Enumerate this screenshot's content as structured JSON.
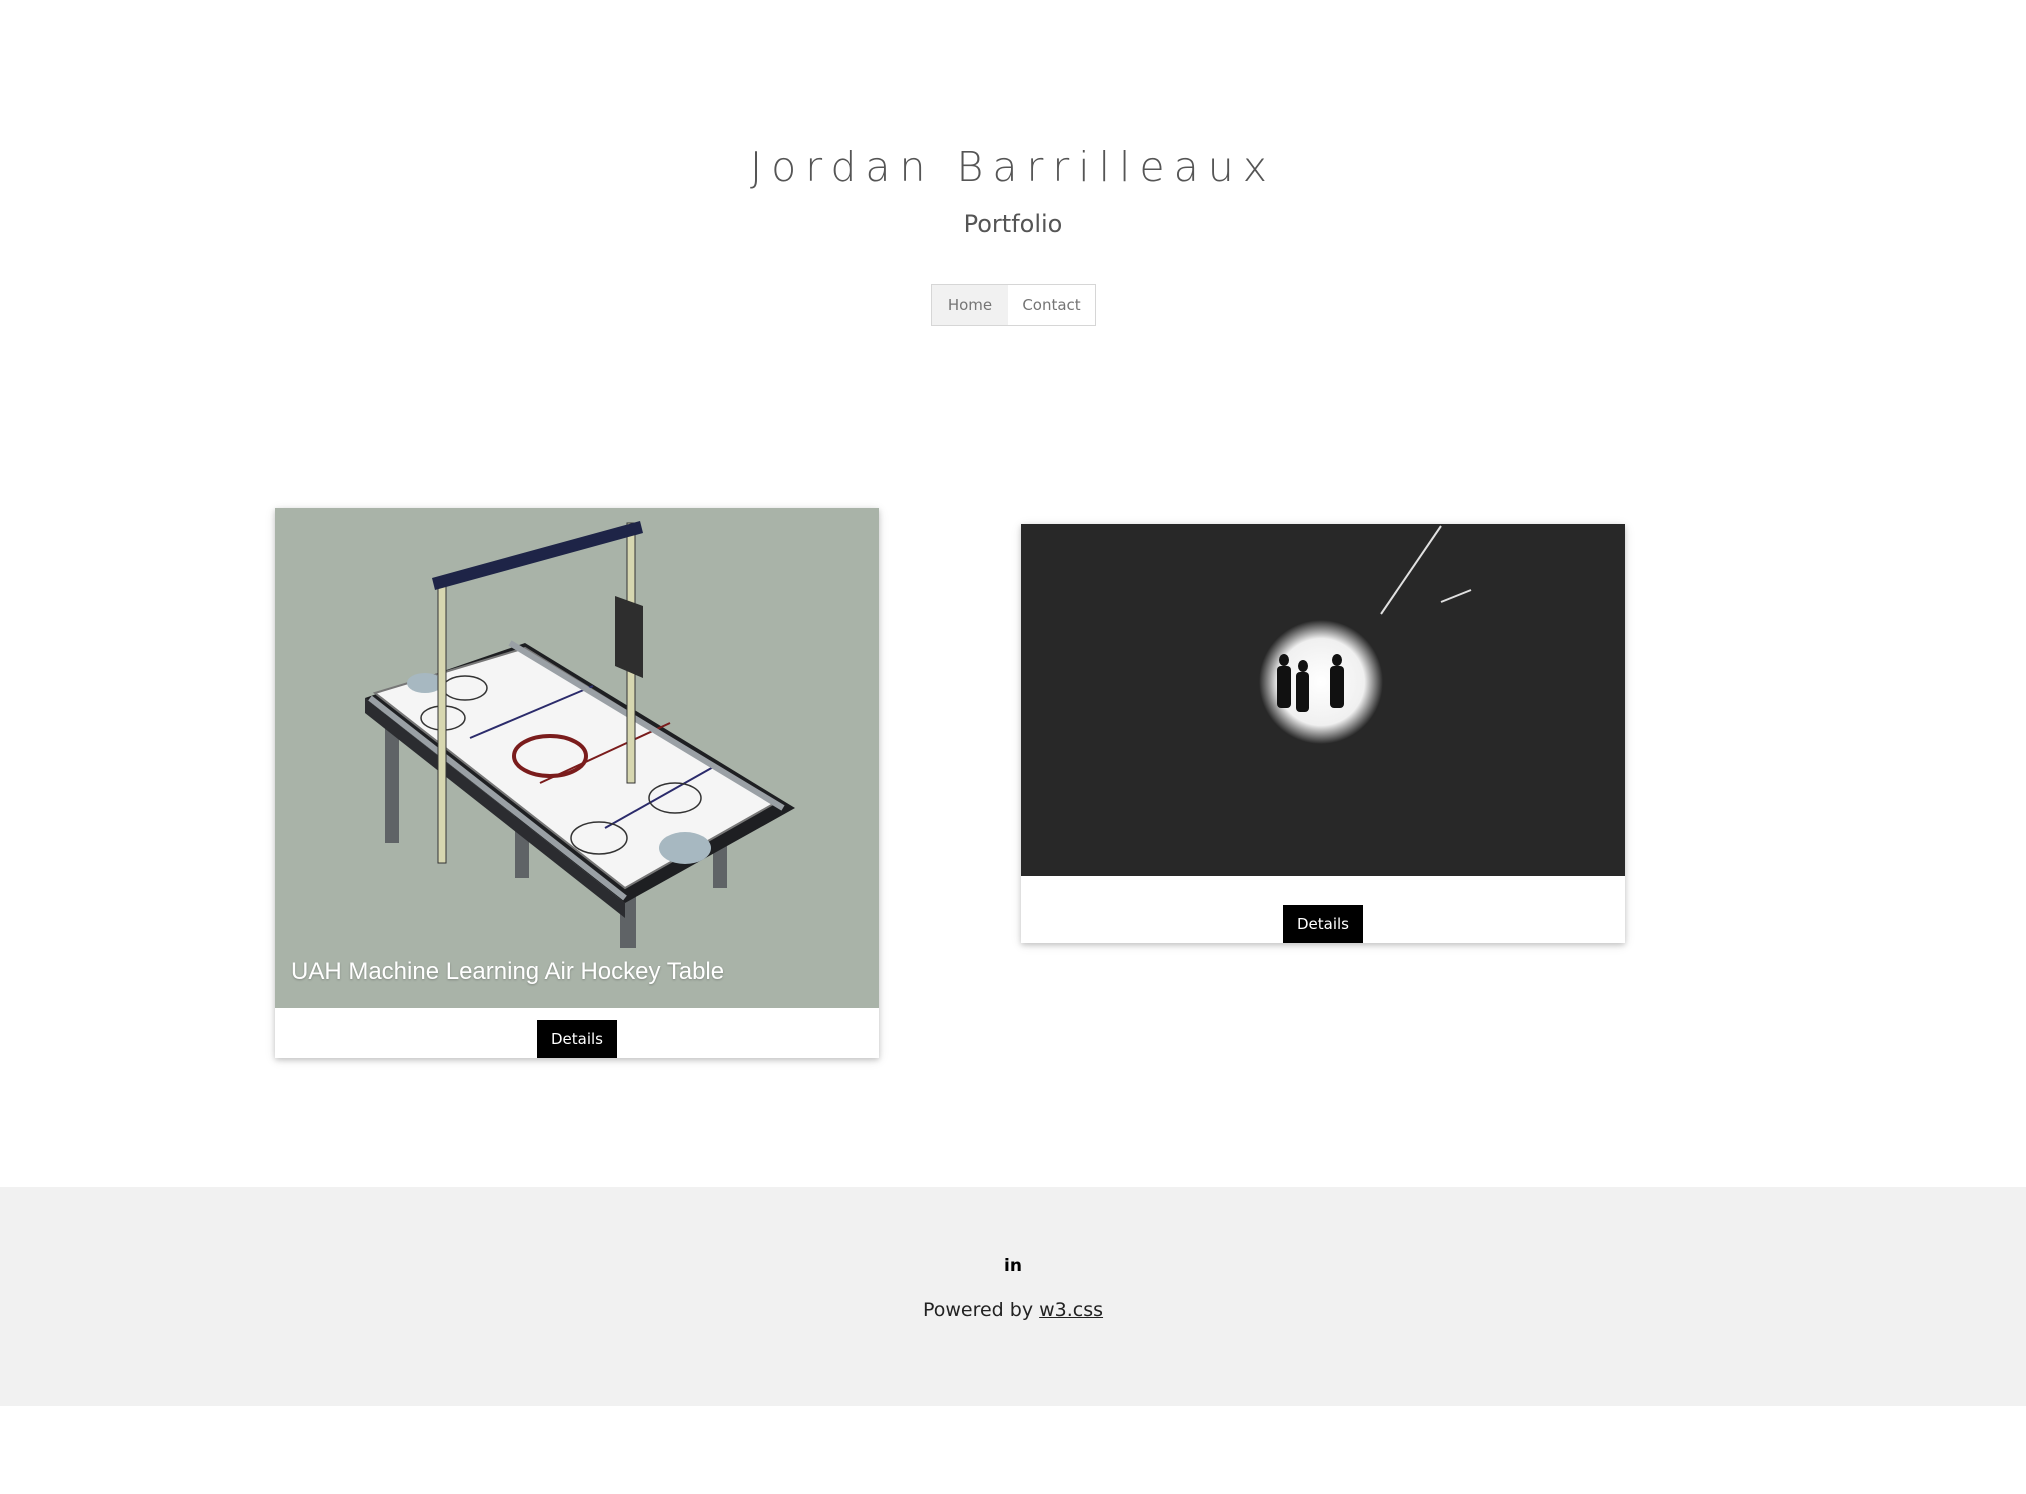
{
  "header": {
    "title": "Jordan Barrilleaux",
    "subtitle": "Portfolio"
  },
  "nav": {
    "items": [
      {
        "label": "Home"
      },
      {
        "label": "Contact"
      }
    ]
  },
  "cards": [
    {
      "caption": "UAH Machine Learning Air Hockey Table",
      "button_label": "Details",
      "image": "air-hockey-table-render"
    },
    {
      "caption": "",
      "button_label": "Details",
      "image": "tunnel-silhouettes-photo"
    }
  ],
  "footer": {
    "social_icon": "in",
    "powered_prefix": "Powered by ",
    "powered_link": "w3.css"
  },
  "colors": {
    "footer_bg": "#f1f1f1",
    "button_bg": "#000000",
    "left_image_bg": "#a9b3a8",
    "right_image_bg": "#282828"
  }
}
